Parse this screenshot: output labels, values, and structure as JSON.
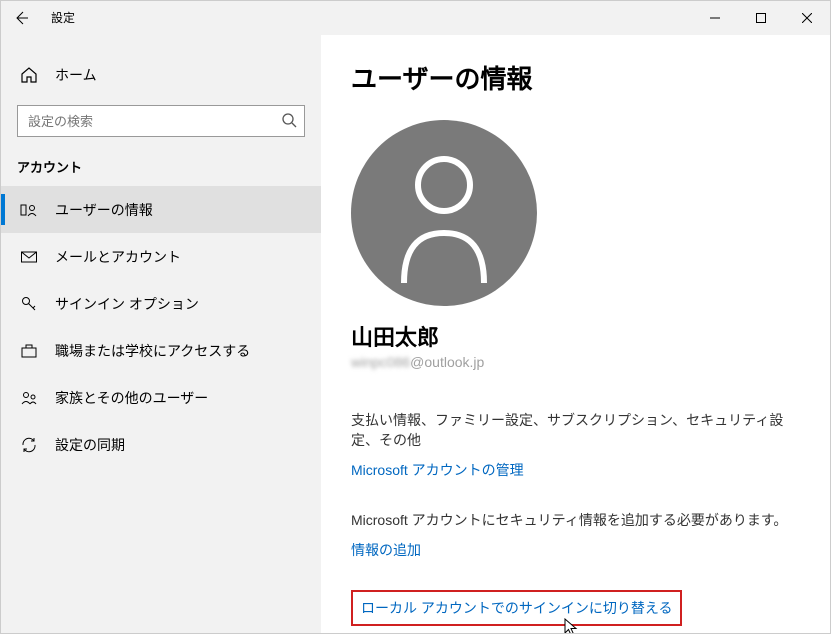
{
  "titlebar": {
    "title": "設定"
  },
  "sidebar": {
    "home_label": "ホーム",
    "search_placeholder": "設定の検索",
    "category": "アカウント",
    "items": [
      {
        "label": "ユーザーの情報"
      },
      {
        "label": "メールとアカウント"
      },
      {
        "label": "サインイン オプション"
      },
      {
        "label": "職場または学校にアクセスする"
      },
      {
        "label": "家族とその他のユーザー"
      },
      {
        "label": "設定の同期"
      }
    ]
  },
  "content": {
    "page_title": "ユーザーの情報",
    "user_name": "山田太郎",
    "user_email_prefix": "winpc086",
    "user_email_suffix": "@outlook.jp",
    "account_desc": "支払い情報、ファミリー設定、サブスクリプション、セキュリティ設定、その他",
    "manage_link": "Microsoft アカウントの管理",
    "security_desc": "Microsoft アカウントにセキュリティ情報を追加する必要があります。",
    "add_info_link": "情報の追加",
    "local_link": "ローカル アカウントでのサインインに切り替える"
  }
}
